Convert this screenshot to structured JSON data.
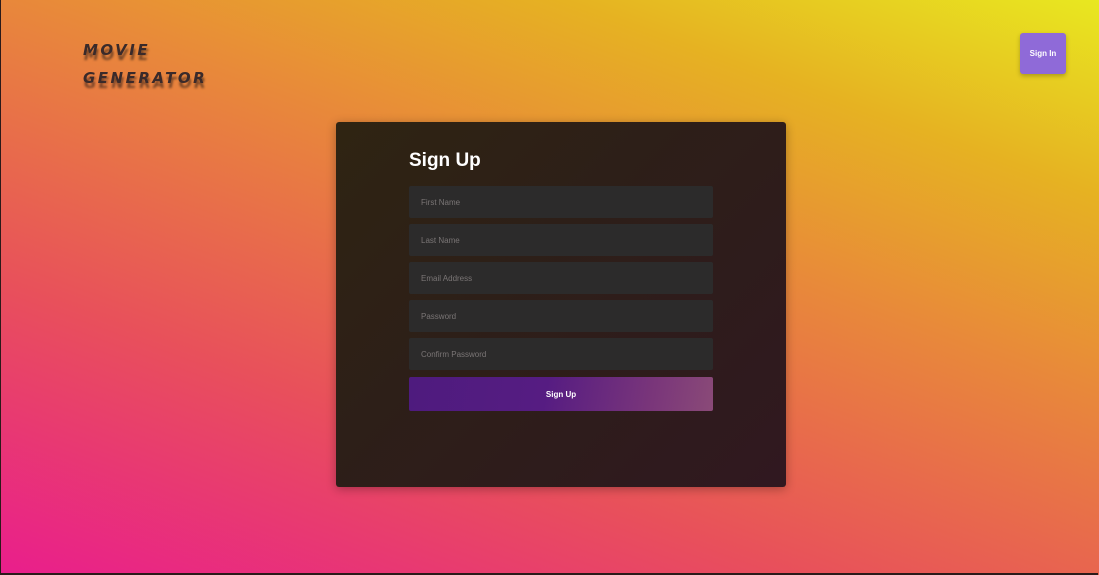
{
  "header": {
    "logo_line1": "MOVIE",
    "logo_line2": "GENERATOR",
    "signin_label": "Sign In"
  },
  "signup": {
    "title": "Sign Up",
    "fields": [
      {
        "placeholder": "First Name",
        "value": ""
      },
      {
        "placeholder": "Last Name",
        "value": ""
      },
      {
        "placeholder": "Email Address",
        "value": ""
      },
      {
        "placeholder": "Password",
        "value": ""
      },
      {
        "placeholder": "Confirm Password",
        "value": ""
      }
    ],
    "submit_label": "Sign Up"
  },
  "colors": {
    "accent": "#8f6ad8",
    "card_background": "#2d1f18",
    "input_background": "#2c2b2b",
    "button_gradient_start": "#4e1b7e",
    "button_gradient_end": "#8a4a78"
  }
}
